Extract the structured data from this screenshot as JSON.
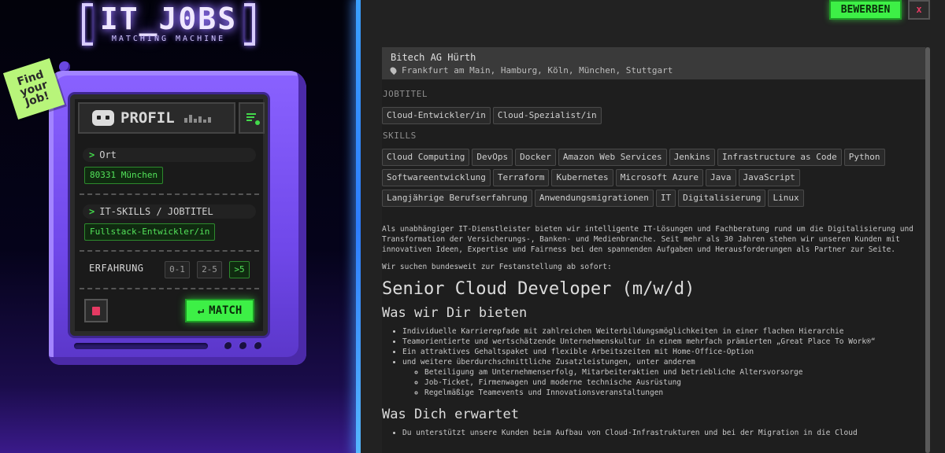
{
  "logo": {
    "title": "IT_J0BS",
    "subtitle": "MATCHING MACHINE"
  },
  "sticky": {
    "text": "Find\nyour\nJob!"
  },
  "profile": {
    "title": "PROFIL",
    "ort_label": "Ort",
    "ort_value": "80331 München",
    "skills_label": "IT-SKILLS / JOBTITEL",
    "skills_value": "Fullstack-Entwickler/in",
    "experience_label": "ERFAHRUNG",
    "experience_options": [
      "0-1",
      "2-5",
      ">5"
    ],
    "experience_selected": ">5",
    "match_label": "MATCH",
    "match_arrow": "↵"
  },
  "toolbar": {
    "apply_label": "BEWERBEN",
    "close_label": "x"
  },
  "job": {
    "company": "Bitech AG Hürth",
    "locations": "Frankfurt am Main, Hamburg, Köln, München, Stuttgart",
    "jobtitle_heading": "JOBTITEL",
    "jobtitles": [
      "Cloud-Entwickler/in",
      "Cloud-Spezialist/in"
    ],
    "skills_heading": "SKILLS",
    "skills": [
      "Cloud Computing",
      "DevOps",
      "Docker",
      "Amazon Web Services",
      "Jenkins",
      "Infrastructure as Code",
      "Python",
      "Softwareentwicklung",
      "Terraform",
      "Kubernetes",
      "Microsoft Azure",
      "Java",
      "JavaScript",
      "Langjährige Berufserfahrung",
      "Anwendungsmigrationen",
      "IT",
      "Digitalisierung",
      "Linux"
    ],
    "intro": "Als unabhängiger IT-Dienstleister bieten wir intelligente IT-Lösungen und Fachberatung rund um die Digitalisierung und Transformation der Versicherungs-, Banken- und Medienbranche. Seit mehr als 30 Jahren stehen wir unseren Kunden mit innovativen Ideen, Expertise und Fairness bei den spannenden Aufgaben und Herausforderungen als Partner zur Seite.",
    "search_line": "Wir suchen bundesweit zur Festanstellung ab sofort:",
    "position_title": "Senior Cloud Developer (m/w/d)",
    "offer_heading": "Was wir Dir bieten",
    "offers": [
      "Individuelle Karrierepfade mit zahlreichen Weiterbildungsmöglichkeiten in einer flachen Hierarchie",
      "Teamorientierte und wertschätzende Unternehmenskultur in einem mehrfach prämierten „Great Place To Work®“",
      "Ein attraktives Gehaltspaket und flexible Arbeitszeiten mit Home-Office-Option",
      "und weitere überdurchschnittliche Zusatzleistungen, unter anderem"
    ],
    "offer_sub": [
      "Beteiligung am Unternehmenserfolg, Mitarbeiteraktien und betriebliche Altersvorsorge",
      "Job-Ticket, Firmenwagen und moderne technische Ausrüstung",
      "Regelmäßige Teamevents und Innovationsveranstaltungen"
    ],
    "expect_heading": "Was Dich erwartet",
    "expect": [
      "Du unterstützt unsere Kunden beim Aufbau von Cloud-Infrastrukturen und bei der Migration in die Cloud"
    ]
  },
  "icons": {
    "profile": "robot-face-icon",
    "filter": "filter-list-icon",
    "trash": "trash-icon",
    "pin": "map-pin-icon"
  },
  "colors": {
    "accent_green": "#3df046",
    "purple": "#7048ea",
    "danger": "#e53a63",
    "glow_blue": "#3aa0ff"
  }
}
